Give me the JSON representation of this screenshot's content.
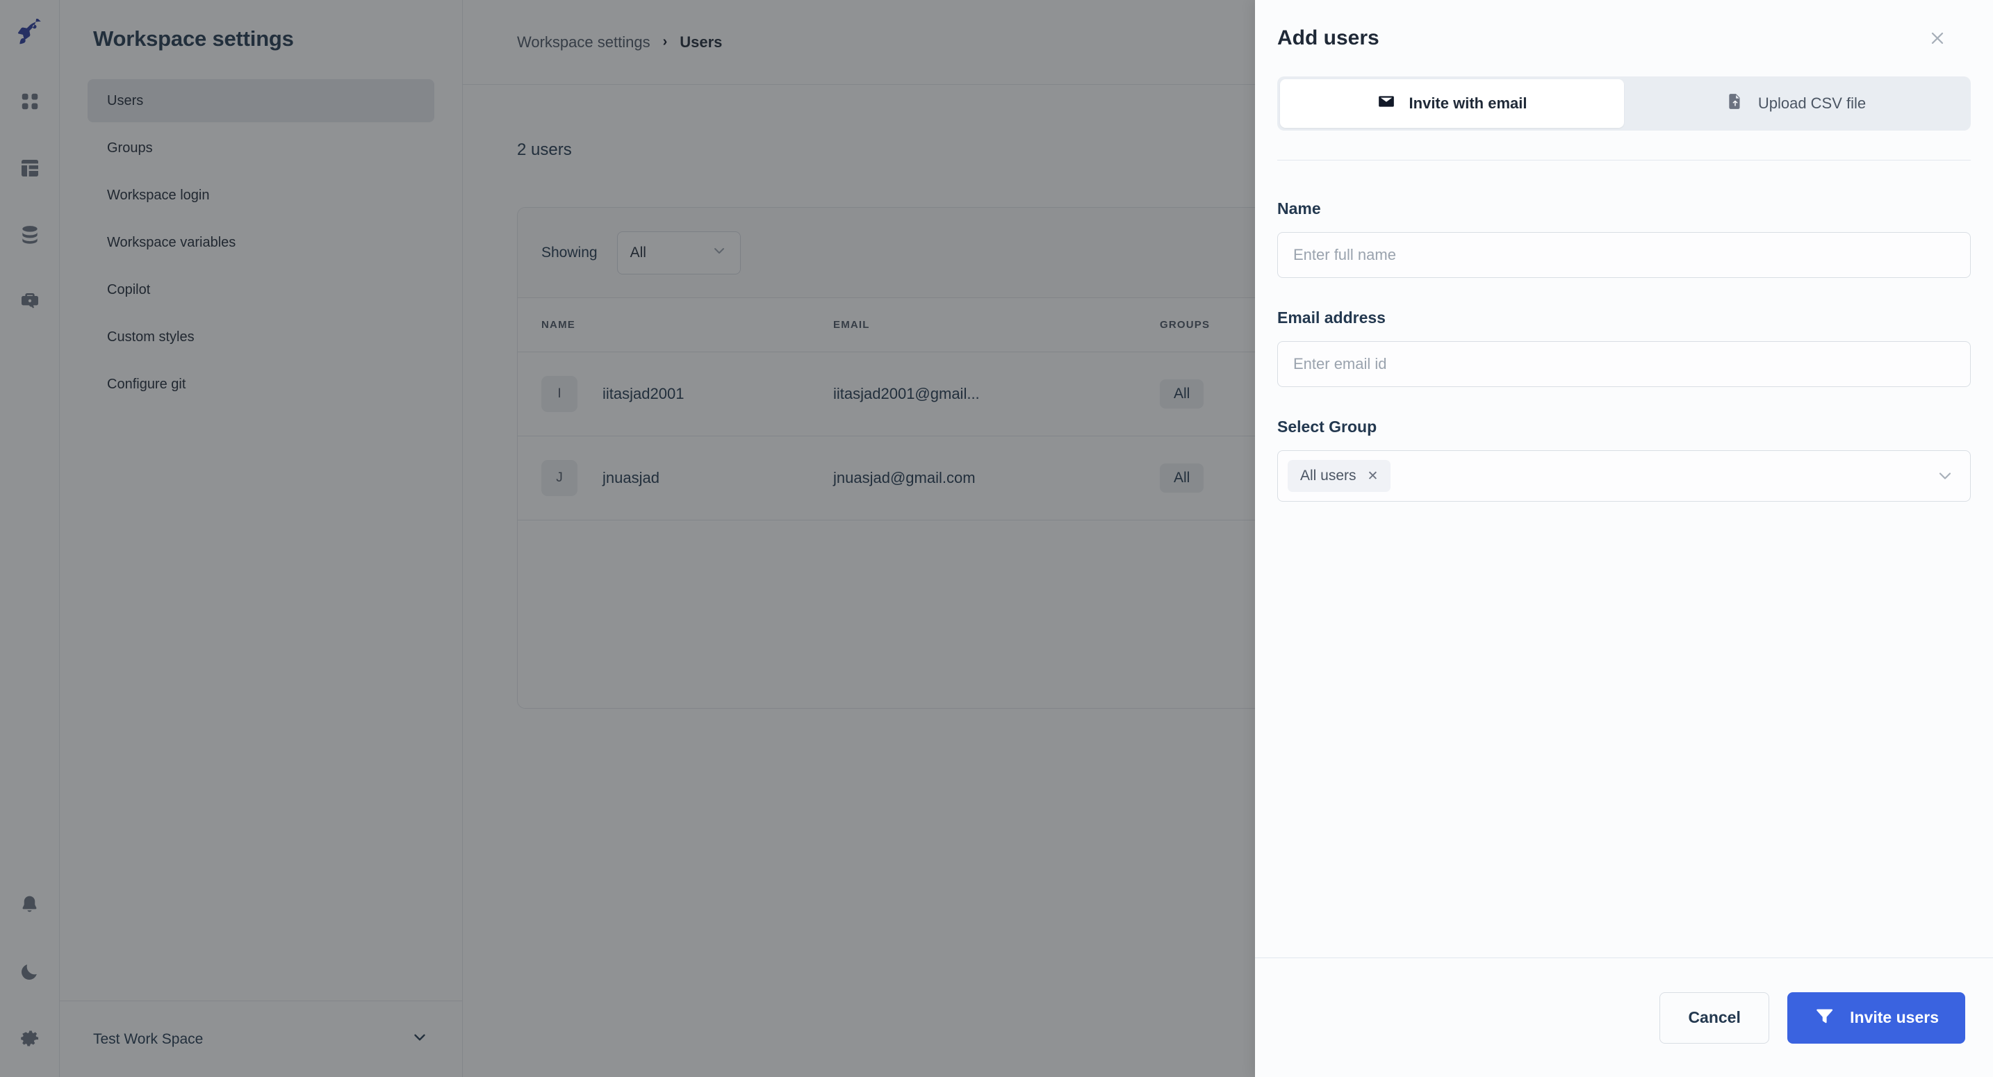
{
  "rail": {
    "logo_icon": "rocket-logo-icon",
    "items": [
      {
        "icon": "apps-grid-icon"
      },
      {
        "icon": "dashboard-layout-icon"
      },
      {
        "icon": "database-icon"
      },
      {
        "icon": "toolbox-key-icon"
      }
    ],
    "bottom_items": [
      {
        "icon": "bell-icon"
      },
      {
        "icon": "moon-dark-mode-icon"
      },
      {
        "icon": "gear-settings-icon"
      }
    ]
  },
  "sidebar": {
    "title": "Workspace settings",
    "items": [
      {
        "label": "Users",
        "active": true
      },
      {
        "label": "Groups",
        "active": false
      },
      {
        "label": "Workspace login",
        "active": false
      },
      {
        "label": "Workspace variables",
        "active": false
      },
      {
        "label": "Copilot",
        "active": false
      },
      {
        "label": "Custom styles",
        "active": false
      },
      {
        "label": "Configure git",
        "active": false
      }
    ],
    "footer": {
      "label": "Test Work Space",
      "icon": "chevron-down-icon"
    }
  },
  "breadcrumb": {
    "parent": "Workspace settings",
    "separator": "›",
    "current": "Users"
  },
  "users_page": {
    "count_text": "2 users",
    "toolbar": {
      "showing_label": "Showing",
      "filter_value": "All",
      "filter_options": [
        "All"
      ]
    },
    "table": {
      "columns": [
        "NAME",
        "EMAIL",
        "GROUPS"
      ],
      "rows": [
        {
          "initial": "I",
          "name": "iitasjad2001",
          "email": "iitasjad2001@gmail...",
          "groups": "All"
        },
        {
          "initial": "J",
          "name": "jnuasjad",
          "email": "jnuasjad@gmail.com",
          "groups": "All"
        }
      ]
    }
  },
  "modal": {
    "title": "Add users",
    "close_icon": "close-icon",
    "tabs": [
      {
        "label": "Invite with email",
        "icon": "envelope-icon",
        "active": true
      },
      {
        "label": "Upload CSV file",
        "icon": "upload-file-icon",
        "active": false
      }
    ],
    "fields": {
      "name": {
        "label": "Name",
        "placeholder": "Enter full name",
        "value": ""
      },
      "email": {
        "label": "Email address",
        "placeholder": "Enter email id",
        "value": ""
      },
      "group": {
        "label": "Select Group",
        "chip": "All users",
        "chip_remove_icon": "chip-remove-icon",
        "caret_icon": "chevron-down-icon"
      }
    },
    "footer": {
      "cancel_label": "Cancel",
      "submit_label": "Invite users",
      "submit_icon": "send-invite-icon"
    }
  },
  "colors": {
    "primary": "#3a63e0",
    "logo": "#2b3a9c",
    "overlay": "rgba(33,37,41,0.5)",
    "text_dark": "#23384f",
    "muted": "#6b7280"
  }
}
